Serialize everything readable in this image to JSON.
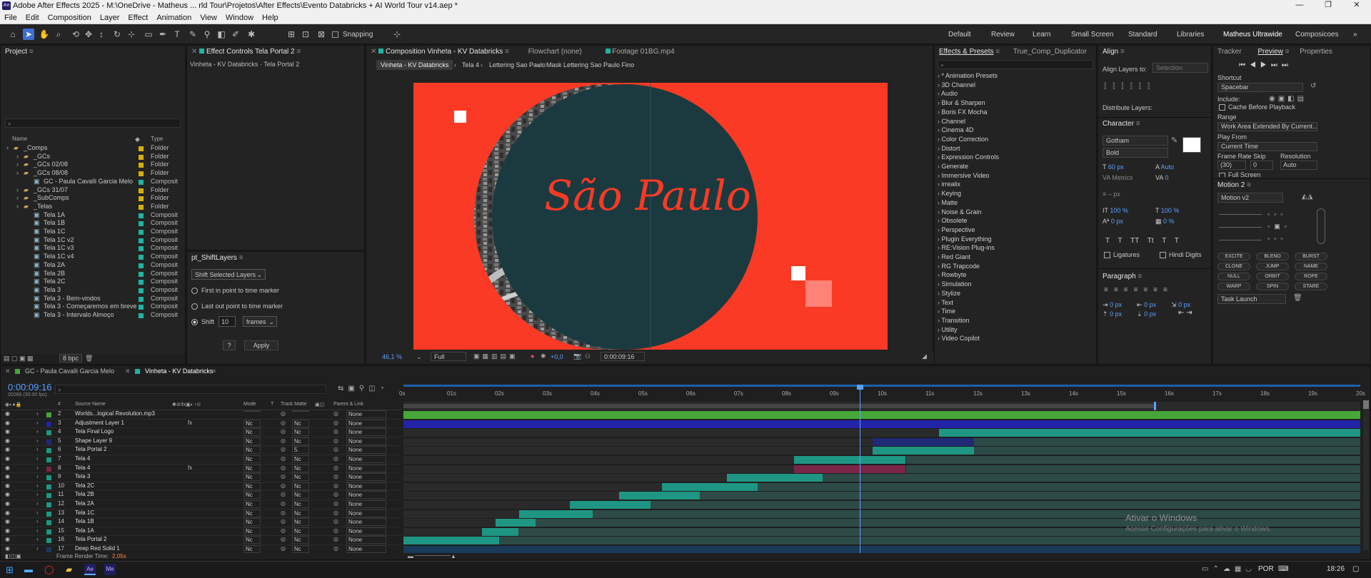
{
  "window": {
    "title": "Adobe After Effects 2025 - M:\\OneDrive - Matheus ... rld Tour\\Projetos\\After Effects\\Evento Databricks + AI World Tour v14.aep *",
    "app_badge": "Ae",
    "ctrl_min": "—",
    "ctrl_max": "❐",
    "ctrl_close": "✕"
  },
  "menu": [
    "File",
    "Edit",
    "Composition",
    "Layer",
    "Effect",
    "Animation",
    "View",
    "Window",
    "Help"
  ],
  "toolbar": {
    "snapping": "Snapping"
  },
  "workspaces": [
    "Default",
    "Review",
    "Learn",
    "Small Screen",
    "Standard",
    "Libraries",
    "Matheus Ultrawide",
    "Composicoes"
  ],
  "project": {
    "title": "Project",
    "search_placeholder": "",
    "col_name": "Name",
    "col_type": "Type",
    "bpc": "8 bpc",
    "items": [
      {
        "name": "_Comps",
        "type": "Folder",
        "color": "#d4b100",
        "indent": 0,
        "icon": "folder"
      },
      {
        "name": "_GCs",
        "type": "Folder",
        "color": "#d4b100",
        "indent": 1,
        "icon": "folder"
      },
      {
        "name": "_GCs 02/08",
        "type": "Folder",
        "color": "#d4b100",
        "indent": 1,
        "icon": "folder"
      },
      {
        "name": "_GCs 08/08",
        "type": "Folder",
        "color": "#d4b100",
        "indent": 1,
        "icon": "folder"
      },
      {
        "name": "GC - Paula Cavalli Garcia Melo",
        "type": "Composit",
        "color": "#1fb3a4",
        "indent": 2,
        "icon": "comp"
      },
      {
        "name": "_GCs 31/07",
        "type": "Folder",
        "color": "#d4b100",
        "indent": 1,
        "icon": "folder"
      },
      {
        "name": "_SubComps",
        "type": "Folder",
        "color": "#d4b100",
        "indent": 1,
        "icon": "folder"
      },
      {
        "name": "_Telas",
        "type": "Folder",
        "color": "#d4b100",
        "indent": 1,
        "icon": "folder"
      },
      {
        "name": "Tela 1A",
        "type": "Composit",
        "color": "#1fb3a4",
        "indent": 2,
        "icon": "comp"
      },
      {
        "name": "Tela 1B",
        "type": "Composit",
        "color": "#1fb3a4",
        "indent": 2,
        "icon": "comp"
      },
      {
        "name": "Tela 1C",
        "type": "Composit",
        "color": "#1fb3a4",
        "indent": 2,
        "icon": "comp"
      },
      {
        "name": "Tela 1C v2",
        "type": "Composit",
        "color": "#1fb3a4",
        "indent": 2,
        "icon": "comp"
      },
      {
        "name": "Tela 1C v3",
        "type": "Composit",
        "color": "#1fb3a4",
        "indent": 2,
        "icon": "comp"
      },
      {
        "name": "Tela 1C v4",
        "type": "Composit",
        "color": "#1fb3a4",
        "indent": 2,
        "icon": "comp"
      },
      {
        "name": "Tela 2A",
        "type": "Composit",
        "color": "#1fb3a4",
        "indent": 2,
        "icon": "comp"
      },
      {
        "name": "Tela 2B",
        "type": "Composit",
        "color": "#1fb3a4",
        "indent": 2,
        "icon": "comp"
      },
      {
        "name": "Tela 2C",
        "type": "Composit",
        "color": "#1fb3a4",
        "indent": 2,
        "icon": "comp"
      },
      {
        "name": "Tela 3",
        "type": "Composit",
        "color": "#1fb3a4",
        "indent": 2,
        "icon": "comp"
      },
      {
        "name": "Tela 3 - Bem-vindos",
        "type": "Composit",
        "color": "#1fb3a4",
        "indent": 2,
        "icon": "comp"
      },
      {
        "name": "Tela 3 - Começaremos em breve",
        "type": "Composit",
        "color": "#1fb3a4",
        "indent": 2,
        "icon": "comp"
      },
      {
        "name": "Tela 3 - Intervalo Almoço",
        "type": "Composit",
        "color": "#1fb3a4",
        "indent": 2,
        "icon": "comp"
      }
    ]
  },
  "effect_controls": {
    "title": "Effect Controls Tela Portal 2",
    "subtitle": "Vinheta - KV Databricks · Tela Portal 2"
  },
  "shiftlayers": {
    "title": "pt_ShiftLayers",
    "mode": "Shift Selected Layers",
    "opt1": "First in point to time marker",
    "opt2": "Last out point to time marker",
    "opt3": "Shift",
    "shift_value": "10",
    "unit": "frames",
    "help": "?",
    "apply": "Apply"
  },
  "viewer": {
    "tabs": [
      "Composition Vinheta - KV Databricks",
      "Flowchart (none)",
      "Footage 01BG.mp4"
    ],
    "crumbs": [
      "Vinheta - KV Databricks",
      "Tela 4",
      "Lettering Sao Paulo",
      "Mask Lettering Sao Paulo Fino"
    ],
    "lettering": "São Paulo",
    "zoom": "46,1 %",
    "quality": "Full",
    "exposure": "+0,0",
    "timecode": "0:00:09:16"
  },
  "effects": {
    "tab1": "Effects & Presets",
    "tab2": "True_Comp_Duplicator",
    "search_placeholder": "",
    "items": [
      "* Animation Presets",
      "3D Channel",
      "Audio",
      "Blur & Sharpen",
      "Boris FX Mocha",
      "Channel",
      "Cinema 4D",
      "Color Correction",
      "Distort",
      "Expression Controls",
      "Generate",
      "Immersive Video",
      "irrealix",
      "Keying",
      "Matte",
      "Noise & Grain",
      "Obsolete",
      "Perspective",
      "Plugin Everything",
      "RE:Vision Plug-ins",
      "Red Giant",
      "RG Trapcode",
      "Rowbyte",
      "Simulation",
      "Stylize",
      "Text",
      "Time",
      "Transition",
      "Utility",
      "Video Copilot"
    ]
  },
  "align": {
    "title": "Align",
    "align_to": "Align Layers to:",
    "target": "Selection",
    "distribute": "Distribute Layers:"
  },
  "character": {
    "title": "Character",
    "font": "Gotham",
    "style": "Bold",
    "size": "60 px",
    "leading": "Auto",
    "kerning": "Metrics",
    "tracking": "0",
    "stroke": "– px",
    "vscale": "100 %",
    "hscale": "100 %",
    "baseline": "0 px",
    "tsume": "0 %",
    "ligatures": "Ligatures",
    "hindi": "Hindi Digits",
    "styles": [
      "T",
      "T",
      "TT",
      "Tt",
      "T",
      "T"
    ]
  },
  "paragraph": {
    "title": "Paragraph",
    "v1": "0 px",
    "v2": "0 px",
    "v3": "0 px",
    "v4": "0 px",
    "v5": "0 px"
  },
  "preview": {
    "tracker": "Tracker",
    "title": "Preview",
    "properties": "Properties",
    "shortcut_lbl": "Shortcut",
    "shortcut": "Spacebar",
    "include": "Include:",
    "cache": "Cache Before Playback",
    "range_lbl": "Range",
    "range": "Work Area Extended By Current...",
    "playfrom_lbl": "Play From",
    "playfrom": "Current Time",
    "fr_lbl": "Frame Rate",
    "skip_lbl": "Skip",
    "res_lbl": "Resolution",
    "fr": "(30)",
    "skip": "0",
    "res": "Auto",
    "fullscreen": "Full Screen"
  },
  "motion": {
    "title": "Motion 2",
    "preset": "Motion v2",
    "buttons": [
      "EXCITE",
      "BLEND",
      "BURST",
      "CLONE",
      "JUMP",
      "NAME",
      "NULL",
      "ORBIT",
      "ROPE",
      "WARP",
      "SPIN",
      "STARE"
    ],
    "task": "Task Launch"
  },
  "timeline": {
    "tab1": "GC - Paula Cavalli Garcia Melo",
    "tab2": "Vinheta - KV Databricks",
    "time": "0:00:09:16",
    "fps": "00286 (30.00 fps)",
    "search_placeholder": "",
    "headers": {
      "num": "#",
      "source": "Source Name",
      "mode": "Mode",
      "t": "T",
      "matte": "Track Matte",
      "parent": "Parent & Link"
    },
    "ticks": [
      "0s",
      "01s",
      "02s",
      "03s",
      "04s",
      "05s",
      "06s",
      "07s",
      "08s",
      "09s",
      "10s",
      "11s",
      "12s",
      "13s",
      "14s",
      "15s",
      "16s",
      "17s",
      "18s",
      "19s",
      "20s"
    ],
    "render_lbl": "Frame Render Time:",
    "render_val": "2,05s",
    "layers": [
      {
        "n": "2",
        "name": "Worlds...logical Revolution.mp3",
        "color": "#47a63a",
        "start": 0.0,
        "end": 1.0,
        "mode": "",
        "matte": "",
        "parent": "None",
        "fx": ""
      },
      {
        "n": "3",
        "name": "Adjustment Layer 1",
        "color": "#2323a8",
        "start": 0.0,
        "end": 1.0,
        "mode": "Nc",
        "matte": "Nc",
        "parent": "None",
        "fx": "fx"
      },
      {
        "n": "4",
        "name": "Tela Final Logo",
        "color": "#1e9683",
        "start": 0.56,
        "end": 1.0,
        "mode": "Nc",
        "matte": "Nc",
        "parent": "None",
        "fx": ""
      },
      {
        "n": "5",
        "name": "Shape Layer 9",
        "color": "#202a78",
        "start": 0.49,
        "end": 0.596,
        "mode": "Nc",
        "matte": "Nc",
        "parent": "None",
        "fx": ""
      },
      {
        "n": "6",
        "name": "Tela Portal 2",
        "color": "#1e9683",
        "start": 0.49,
        "end": 0.596,
        "mode": "Nc",
        "matte": "5.",
        "parent": "None",
        "fx": ""
      },
      {
        "n": "7",
        "name": "Tela 4",
        "color": "#1e9683",
        "start": 0.408,
        "end": 0.525,
        "mode": "Nc",
        "matte": "Nc",
        "parent": "None",
        "fx": ""
      },
      {
        "n": "8",
        "name": "Tela 4",
        "color": "#7a2547",
        "start": 0.408,
        "end": 0.525,
        "mode": "Nc",
        "matte": "Nc",
        "parent": "None",
        "fx": "fx"
      },
      {
        "n": "9",
        "name": "Tela 3",
        "color": "#1e9683",
        "start": 0.338,
        "end": 0.438,
        "mode": "Nc",
        "matte": "Nc",
        "parent": "None",
        "fx": ""
      },
      {
        "n": "10",
        "name": "Tela 2C",
        "color": "#1e9683",
        "start": 0.27,
        "end": 0.37,
        "mode": "Nc",
        "matte": "Nc",
        "parent": "None",
        "fx": ""
      },
      {
        "n": "11",
        "name": "Tela 2B",
        "color": "#1e9683",
        "start": 0.225,
        "end": 0.31,
        "mode": "Nc",
        "matte": "Nc",
        "parent": "None",
        "fx": ""
      },
      {
        "n": "12",
        "name": "Tela 2A",
        "color": "#1e9683",
        "start": 0.174,
        "end": 0.258,
        "mode": "Nc",
        "matte": "Nc",
        "parent": "None",
        "fx": ""
      },
      {
        "n": "13",
        "name": "Tela 1C",
        "color": "#1e9683",
        "start": 0.121,
        "end": 0.198,
        "mode": "Nc",
        "matte": "Nc",
        "parent": "None",
        "fx": ""
      },
      {
        "n": "14",
        "name": "Tela 1B",
        "color": "#1e9683",
        "start": 0.096,
        "end": 0.138,
        "mode": "Nc",
        "matte": "Nc",
        "parent": "None",
        "fx": ""
      },
      {
        "n": "15",
        "name": "Tela 1A",
        "color": "#1e9683",
        "start": 0.082,
        "end": 0.12,
        "mode": "Nc",
        "matte": "Nc",
        "parent": "None",
        "fx": ""
      },
      {
        "n": "16",
        "name": "Tela Portal 2",
        "color": "#1e9683",
        "start": 0.0,
        "end": 0.1,
        "mode": "Nc",
        "matte": "Nc",
        "parent": "None",
        "fx": ""
      },
      {
        "n": "17",
        "name": "Deep Red Solid 1",
        "color": "#1a3a5a",
        "start": 0.0,
        "end": 1.0,
        "mode": "Nc",
        "matte": "Nc",
        "parent": "None",
        "fx": ""
      }
    ]
  },
  "watermark": {
    "line1": "Ativar o Windows",
    "line2": "Acesse Configurações para ativar o Windows."
  },
  "taskbar": {
    "time": "18:26",
    "lang": "POR"
  }
}
